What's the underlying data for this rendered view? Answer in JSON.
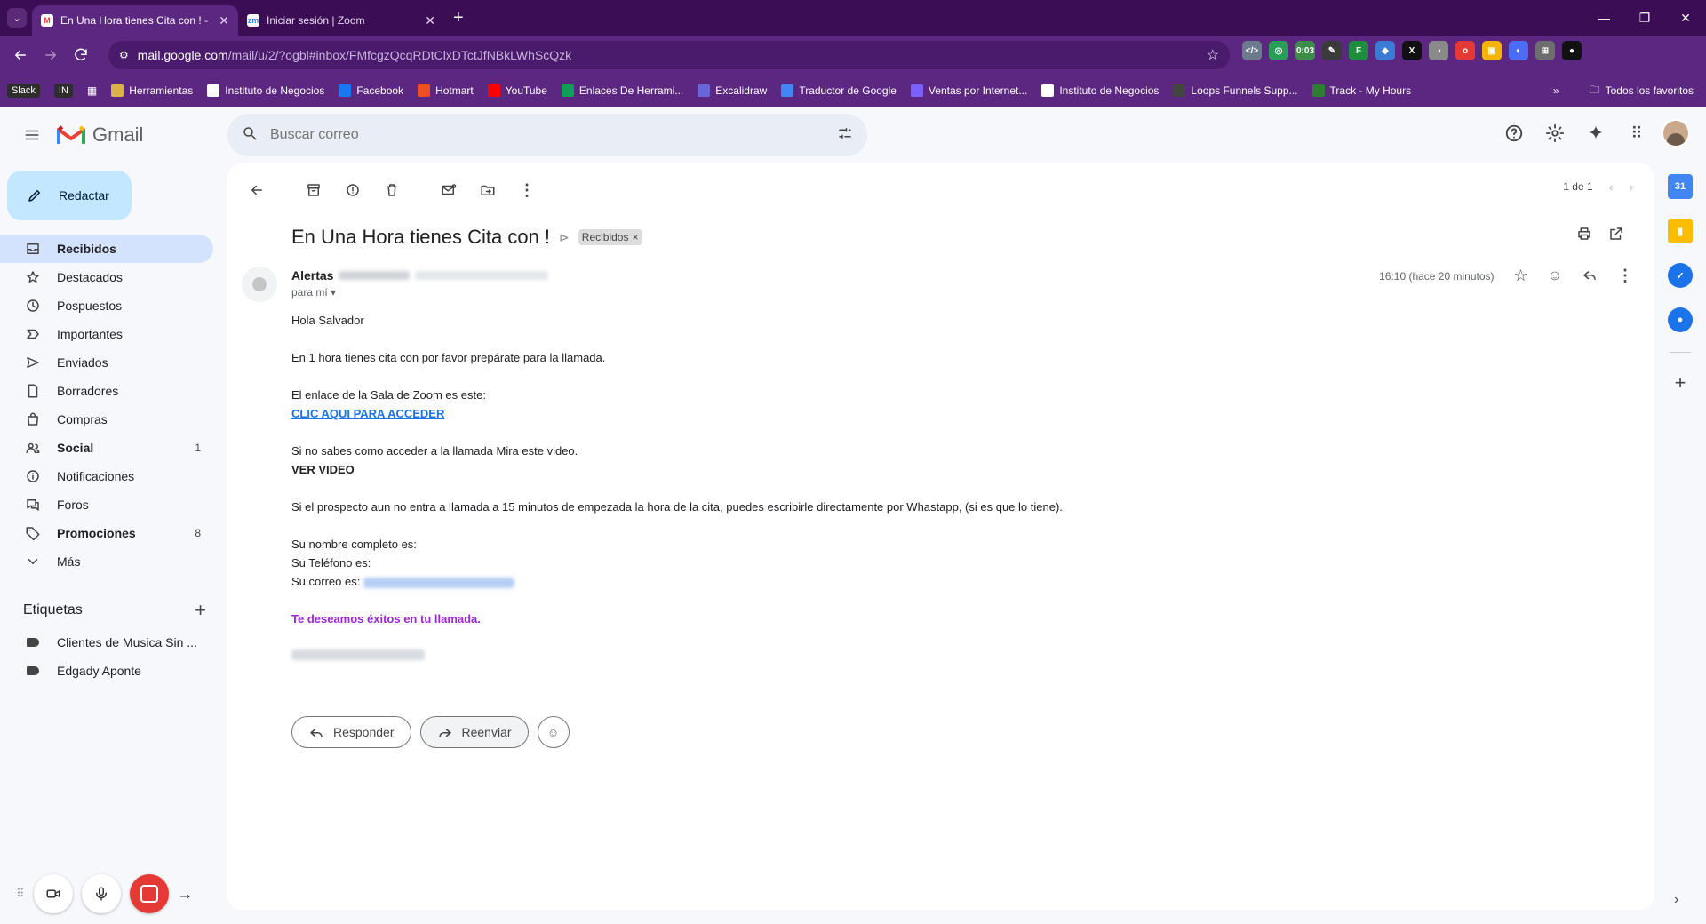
{
  "browser": {
    "tabs": [
      {
        "title": "En Una Hora tienes Cita con ! -",
        "icon": "M",
        "icon_color": "#ea4335",
        "active": true
      },
      {
        "title": "Iniciar sesión | Zoom",
        "icon": "zm",
        "icon_color": "#2d8cff",
        "active": false
      }
    ],
    "url_domain": "mail.google.com",
    "url_path": "/mail/u/2/?ogbl#inbox/FMfcgzQcqRDtClxDTctJfNBkLWhScQzk",
    "extensions": [
      {
        "label": "</>",
        "color": "#6b7a8c"
      },
      {
        "label": "◎",
        "color": "#2a9d58"
      },
      {
        "label": "0:03",
        "color": "#3c8c4a"
      },
      {
        "label": "✎",
        "color": "#3b3b3b"
      },
      {
        "label": "F",
        "color": "#1e8e3e"
      },
      {
        "label": "◆",
        "color": "#3a7bd5"
      },
      {
        "label": "X",
        "color": "#111111"
      },
      {
        "label": "◑",
        "color": "#8a8a8a"
      },
      {
        "label": "o",
        "color": "#e53935"
      },
      {
        "label": "▣",
        "color": "#f4b400"
      },
      {
        "label": "◐",
        "color": "#4a6cf7"
      },
      {
        "label": "⊞",
        "color": "#6d6d6d"
      },
      {
        "label": "●",
        "color": "#111111"
      }
    ],
    "bookmarks": [
      {
        "label": "Herramientas",
        "icon": "folder"
      },
      {
        "label": "Instituto de Negocios",
        "icon": "in"
      },
      {
        "label": "Facebook",
        "icon": "f"
      },
      {
        "label": "Hotmart",
        "icon": "h"
      },
      {
        "label": "YouTube",
        "icon": "yt"
      },
      {
        "label": "Enlaces De Herrami...",
        "icon": "sheet"
      },
      {
        "label": "Excalidraw",
        "icon": "ex"
      },
      {
        "label": "Traductor de Google",
        "icon": "gt"
      },
      {
        "label": "Ventas por Internet...",
        "icon": "vi"
      },
      {
        "label": "Instituto de Negocios",
        "icon": "in"
      },
      {
        "label": "Loops Funnels Supp...",
        "icon": "lf"
      },
      {
        "label": "Track - My Hours",
        "icon": "mh"
      }
    ],
    "bookmark_badges": [
      "Slack",
      "IN"
    ],
    "other_bookmarks": "Todos los favoritos"
  },
  "gmail": {
    "logo_text": "Gmail",
    "search_placeholder": "Buscar correo",
    "compose_label": "Redactar",
    "nav": [
      {
        "label": "Recibidos",
        "icon": "inbox",
        "active": true,
        "bold": true,
        "count": ""
      },
      {
        "label": "Destacados",
        "icon": "star",
        "count": ""
      },
      {
        "label": "Pospuestos",
        "icon": "clock",
        "count": ""
      },
      {
        "label": "Importantes",
        "icon": "important",
        "count": ""
      },
      {
        "label": "Enviados",
        "icon": "send",
        "count": ""
      },
      {
        "label": "Borradores",
        "icon": "draft",
        "count": ""
      },
      {
        "label": "Compras",
        "icon": "bag",
        "count": ""
      },
      {
        "label": "Social",
        "icon": "social",
        "bold": true,
        "count": "1"
      },
      {
        "label": "Notificaciones",
        "icon": "info",
        "count": ""
      },
      {
        "label": "Foros",
        "icon": "forum",
        "count": ""
      },
      {
        "label": "Promociones",
        "icon": "tag",
        "bold": true,
        "count": "8"
      },
      {
        "label": "Más",
        "icon": "chevron-down",
        "count": ""
      }
    ],
    "labels_title": "Etiquetas",
    "labels": [
      "Clientes de Musica Sin ...",
      "Edgady Aponte"
    ]
  },
  "email": {
    "pager": "1 de 1",
    "subject": "En Una Hora tienes Cita con !",
    "label_chip": "Recibidos",
    "sender_name": "Alertas",
    "to_me": "para mí",
    "time": "16:10 (hace 20 minutos)",
    "greeting": "Hola Salvador",
    "line1": "En 1 hora tienes cita con por favor prepárate para la llamada.",
    "line2": "El enlace de la Sala de Zoom es este:",
    "link_text": "CLIC AQUI PARA ACCEDER",
    "line3": "Si no sabes como acceder a la llamada Mira este video.",
    "video_text": "VER VIDEO",
    "line4": "Si el prospecto aun no entra a llamada a 15 minutos de empezada la hora de la cita, puedes escribirle directamente por Whastapp, (si es que lo tiene).",
    "name_line": "Su nombre completo es:",
    "phone_line": "Su Teléfono es:",
    "email_line": "Su correo es:",
    "wish_line": "Te deseamos éxitos en tu llamada.",
    "reply_label": "Responder",
    "forward_label": "Reenviar"
  }
}
